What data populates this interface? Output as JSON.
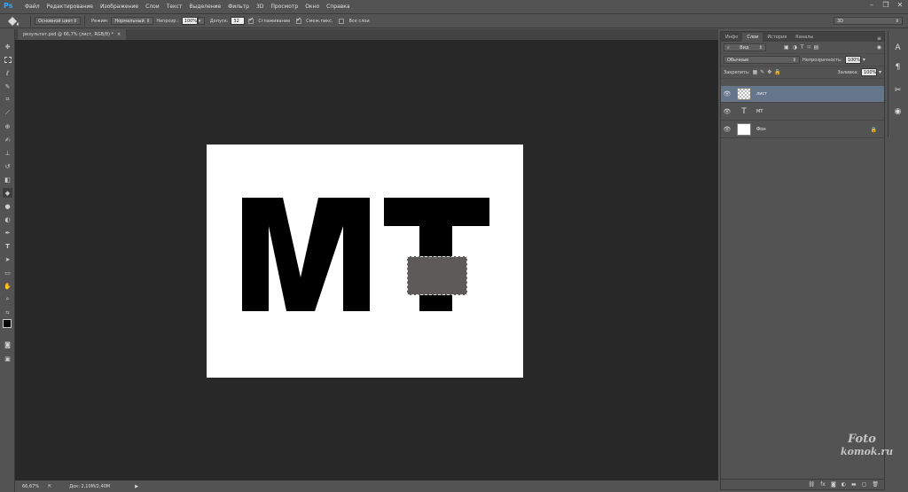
{
  "menubar": {
    "logo": "Ps",
    "items": [
      "Файл",
      "Редактирование",
      "Изображение",
      "Слои",
      "Текст",
      "Выделение",
      "Фильтр",
      "3D",
      "Просмотр",
      "Окно",
      "Справка"
    ],
    "workspace_value": "3D"
  },
  "options": {
    "source_select": "Основной цвет",
    "mode_label": "Режим:",
    "mode_value": "Нормальный",
    "opacity_label": "Непрозр.:",
    "opacity_value": "100%",
    "tolerance_label": "Допуск:",
    "tolerance_value": "32",
    "antialias_label": "Сглаживание",
    "contiguous_label": "Смеж.пикс.",
    "all_layers_label": "Все слои"
  },
  "document": {
    "tab_title": "результат.psd @ 66,7% (лист, RGB/8) *",
    "tab_close": "×",
    "zoom": "66,67%",
    "doc_info": "Док: 2,10M/2,40M",
    "canvas_text": "MT"
  },
  "layers_panel": {
    "tabs": [
      "Инфо",
      "Слои",
      "История",
      "Каналы"
    ],
    "active_tab": "Слои",
    "filter_select": "Вид",
    "blend_select": "Обычные",
    "opacity_label": "Непрозрачность:",
    "opacity_value": "100%",
    "lock_label": "Закрепить:",
    "fill_label": "Заливка:",
    "fill_value": "100%",
    "layers": [
      {
        "name": "лист",
        "type": "pixel",
        "selected": true
      },
      {
        "name": "МТ",
        "type": "text",
        "selected": false
      },
      {
        "name": "Фон",
        "type": "background",
        "selected": false
      }
    ]
  },
  "watermark": {
    "line1": "Foto",
    "line2": "komok.ru"
  },
  "colors": {
    "workspace": "#282828",
    "panel": "#535353",
    "selected_layer": "#65758a",
    "canvas": "#ffffff",
    "patch_fill": "#5f5a5a"
  }
}
